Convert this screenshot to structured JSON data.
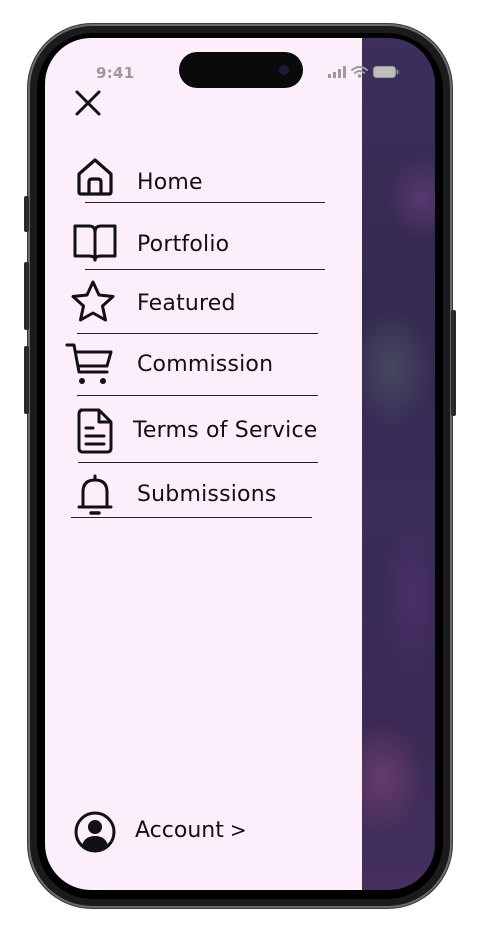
{
  "status_bar": {
    "time": "9:41"
  },
  "menu": {
    "close_icon": "close-icon",
    "items": [
      {
        "label": "Home",
        "icon": "home-icon"
      },
      {
        "label": "Portfolio",
        "icon": "book-icon"
      },
      {
        "label": "Featured",
        "icon": "star-icon"
      },
      {
        "label": "Commission",
        "icon": "cart-icon"
      },
      {
        "label": "Terms of Service",
        "icon": "document-icon"
      },
      {
        "label": "Submissions",
        "icon": "bell-icon"
      }
    ]
  },
  "account": {
    "label": "Account",
    "chevron": ">",
    "icon": "user-circle-icon"
  },
  "colors": {
    "drawer_background": "#fdeefc",
    "backdrop": "#3d2f5c",
    "text": "#111111"
  }
}
